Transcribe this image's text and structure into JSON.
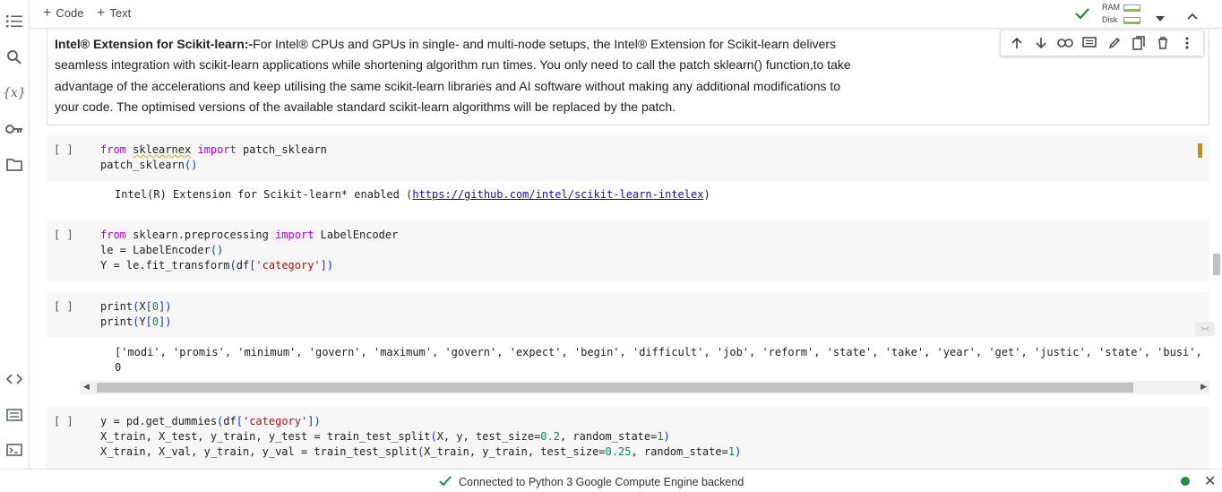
{
  "toolbar": {
    "add_code": "Code",
    "add_text": "Text",
    "ram_label": "RAM",
    "disk_label": "Disk"
  },
  "icons": {
    "toc": "table-of-contents-icon",
    "search": "search-icon",
    "variables": "variables-icon",
    "secrets": "key-icon",
    "files": "folder-icon",
    "code_snippets": "code-icon",
    "command_palette": "command-palette-icon",
    "terminal": "terminal-icon"
  },
  "text_cell": {
    "bold_lead": "Intel® Extension for Scikit-learn:-",
    "body": "For Intel® CPUs and GPUs in single- and multi-node setups, the Intel® Extension for Scikit-learn delivers seamless integration with scikit-learn applications while shortening algorithm run times. You only need to call the patch sklearn() function,to take advantage of the accelerations and keep utilising the same scikit-learn libraries and AI software without making any additional modifications to your code. The optimised versions of the available standard scikit-learn algorithms will be replaced by the patch."
  },
  "cells": {
    "run_label": "[ ]",
    "c1_output_prefix": "Intel(R) Extension for Scikit-learn* enabled (",
    "c1_output_link": "https://github.com/intel/scikit-learn-intelex",
    "c1_output_suffix": ")",
    "c3_output_line1": "['modi', 'promis', 'minimum', 'govern', 'maximum', 'govern', 'expect', 'begin', 'difficult', 'job', 'reform', 'state', 'take', 'year', 'get', 'justic', 'state', 'busi', 'exit', 'psu",
    "c3_output_line2": "0"
  },
  "status": {
    "message": "Connected to Python 3 Google Compute Engine backend"
  },
  "colors": {
    "keyword": "#af00db",
    "paren": "#0431fa",
    "string": "#a31515",
    "number": "#098658",
    "status_ok": "#1e8e3e",
    "cell_bg": "#f7f7f7"
  }
}
